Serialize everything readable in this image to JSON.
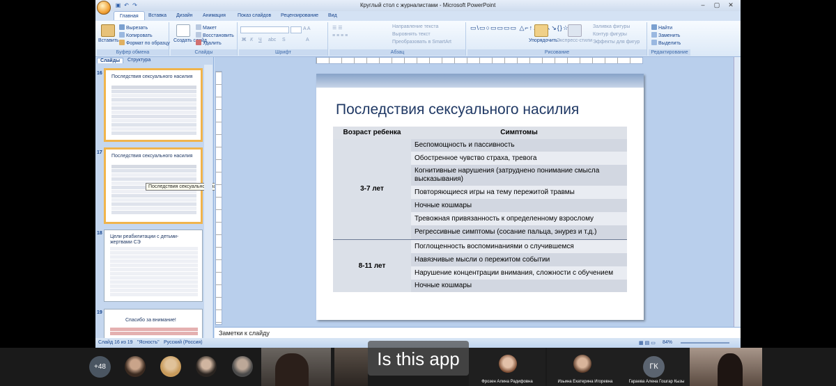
{
  "window": {
    "title": "Круглый стол с журналистами - Microsoft PowerPoint"
  },
  "ribbon_tabs": [
    "Главная",
    "Вставка",
    "Дизайн",
    "Анимация",
    "Показ слайдов",
    "Рецензирование",
    "Вид"
  ],
  "ribbon": {
    "clipboard": {
      "paste": "Вставить",
      "cut": "Вырезать",
      "copy": "Копировать",
      "format_painter": "Формат по образцу",
      "label": "Буфер обмена"
    },
    "slides": {
      "new_slide": "Создать слайд",
      "layout": "Макет",
      "reset": "Восстановить",
      "delete": "Удалить",
      "label": "Слайды"
    },
    "font": {
      "label": "Шрифт"
    },
    "paragraph": {
      "text_direction": "Направление текста",
      "align_text": "Выровнять текст",
      "smartart": "Преобразовать в SmartArt",
      "label": "Абзац"
    },
    "drawing": {
      "arrange": "Упорядочить",
      "quick_styles": "Экспресс-стили",
      "shape_fill": "Заливка фигуры",
      "shape_outline": "Контур фигуры",
      "shape_effects": "Эффекты для фигур",
      "label": "Рисование"
    },
    "editing": {
      "find": "Найти",
      "replace": "Заменить",
      "select": "Выделить",
      "label": "Редактирование"
    }
  },
  "left_pane": {
    "tabs": [
      "Слайды",
      "Структура"
    ],
    "thumbs": [
      {
        "num": "16",
        "title": "Последствия сексуального насилия"
      },
      {
        "num": "17",
        "title": "Последствия сексуального насилия"
      },
      {
        "num": "18",
        "title": "Цели реабилитации с детьми-жертвами СЭ"
      },
      {
        "num": "19",
        "title": "Спасибо за внимание!"
      }
    ],
    "tooltip": "Последствия сексуального на..."
  },
  "slide": {
    "title": "Последствия сексуального насилия",
    "table": {
      "headers": [
        "Возраст ребенка",
        "Симптомы"
      ],
      "groups": [
        {
          "age": "3-7 лет",
          "symptoms": [
            "Беспомощность и пассивность",
            "Обостренное чувство страха, тревога",
            "Когнитивные нарушения (затруднено понимание смысла высказывания)",
            "Повторяющиеся игры на тему пережитой травмы",
            "Ночные кошмары",
            "Тревожная привязанность к определенному взрослому",
            "Регрессивные симптомы (сосание пальца, энурез и т.д.)"
          ]
        },
        {
          "age": "8-11 лет",
          "symptoms": [
            "Поглощенность воспоминаниями о случившемся",
            "Навязчивые мысли о пережитом событии",
            "Нарушение концентрации внимания, сложности с обучением",
            "Ночные кошмары"
          ]
        }
      ]
    }
  },
  "notes_placeholder": "Заметки к слайду",
  "status": {
    "slide_pos": "Слайд 16 из 19",
    "theme": "\"Ясность\"",
    "language": "Русский (Россия)",
    "zoom": "84%"
  },
  "meeting": {
    "more_count": "+48",
    "caption": "Is this app",
    "participants": [
      {
        "name": "Фрозен Алина Радифовна"
      },
      {
        "name": "Изьина Екатерина Игоревна"
      },
      {
        "name": "Гараева Алена Гошгар Кызы",
        "initials": "ГК"
      }
    ]
  }
}
